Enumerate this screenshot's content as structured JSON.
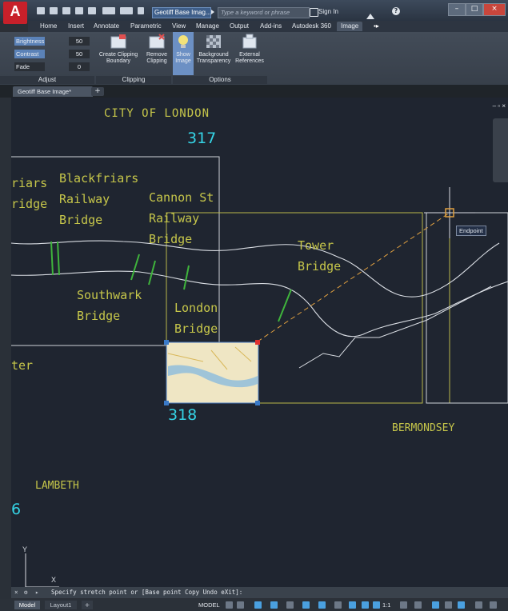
{
  "app": {
    "logo_letter": "A",
    "document_title": "Geotiff Base Imag...",
    "search_placeholder": "Type a keyword or phrase",
    "sign_in": "Sign In"
  },
  "ribbon_tabs": [
    "Home",
    "Insert",
    "Annotate",
    "Parametric",
    "View",
    "Manage",
    "Output",
    "Add-ins",
    "Autodesk 360",
    "Image"
  ],
  "active_tab": "Image",
  "adjust_panel": {
    "title": "Adjust",
    "sliders": [
      {
        "label": "Brightness",
        "value": "50"
      },
      {
        "label": "Contrast",
        "value": "50"
      },
      {
        "label": "Fade",
        "value": "0"
      }
    ]
  },
  "clipping_panel": {
    "title": "Clipping",
    "create_label": [
      "Create Clipping",
      "Boundary"
    ],
    "remove_label": [
      "Remove",
      "Clipping"
    ]
  },
  "options_panel": {
    "title": "Options",
    "show_image_label": [
      "Show",
      "Image"
    ],
    "background_label": [
      "Background",
      "Transparency"
    ],
    "external_label": [
      "External",
      "References"
    ]
  },
  "doc_tab": {
    "label": "Geotiff Base Image*",
    "add_label": "+"
  },
  "drawing": {
    "labels": {
      "city_of_london": "CITY OF LONDON",
      "num_317": "317",
      "blackfriars_1": "Blackfriars",
      "blackfriars_2": "Railway",
      "blackfriars_3": "Bridge",
      "friars": "riars",
      "ridge": "ridge",
      "cannon_1": "Cannon St",
      "cannon_2": "Railway",
      "cannon_3": "Bridge",
      "tower_1": "Tower",
      "tower_2": "Bridge",
      "southwark_1": "Southwark",
      "southwark_2": "Bridge",
      "london_1": "London",
      "london_2": "Bridge",
      "ter": "ter",
      "num_318": "318",
      "bermondsey": "BERMONDSEY",
      "lambeth": "LAMBETH",
      "num_6": "6",
      "endpoint_tooltip": "Endpoint",
      "ucs_y": "Y",
      "ucs_x": "X"
    },
    "colors": {
      "label_yellow": "#c6c64a",
      "number_cyan": "#35d4e6",
      "street_white": "#d8dce2",
      "bridge_green": "#3fb43c",
      "frame_yellow": "#b8b84a"
    }
  },
  "command_line": {
    "prompt": "Specify stretch point or [Base point Copy Undo eXit]:"
  },
  "status": {
    "model_tab": "Model",
    "layout_tab": "Layout1",
    "model_label": "MODEL",
    "scale": "1:1"
  }
}
